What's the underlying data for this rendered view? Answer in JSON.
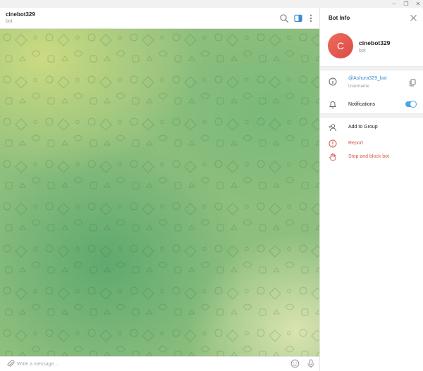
{
  "window": {
    "minimize_glyph": "–",
    "maximize_glyph": "❐",
    "close_glyph": "✕"
  },
  "chat": {
    "title": "cinebot329",
    "status": "bot",
    "icons": [
      "search-icon",
      "side-panel-icon",
      "more-vertical-icon"
    ]
  },
  "composer": {
    "placeholder": "Write a message...",
    "value": "",
    "icons": [
      "paperclip-icon",
      "emoji-icon",
      "microphone-icon"
    ]
  },
  "info_panel": {
    "header_title": "Bot Info",
    "avatar_letter": "C",
    "avatar_color": "#e65a50",
    "name": "cinebot329",
    "subtitle": "bot",
    "username": "@Ashura329_bot",
    "username_caption": "Username",
    "notifications_label": "Notifications",
    "notifications_enabled": true,
    "actions": {
      "add_to_group": "Add to Group",
      "report": "Report",
      "stop_and_block": "Stop and block bot"
    }
  },
  "colors": {
    "accent": "#4aa6e0",
    "danger": "#d25a4e",
    "link": "#3a8bd0"
  }
}
